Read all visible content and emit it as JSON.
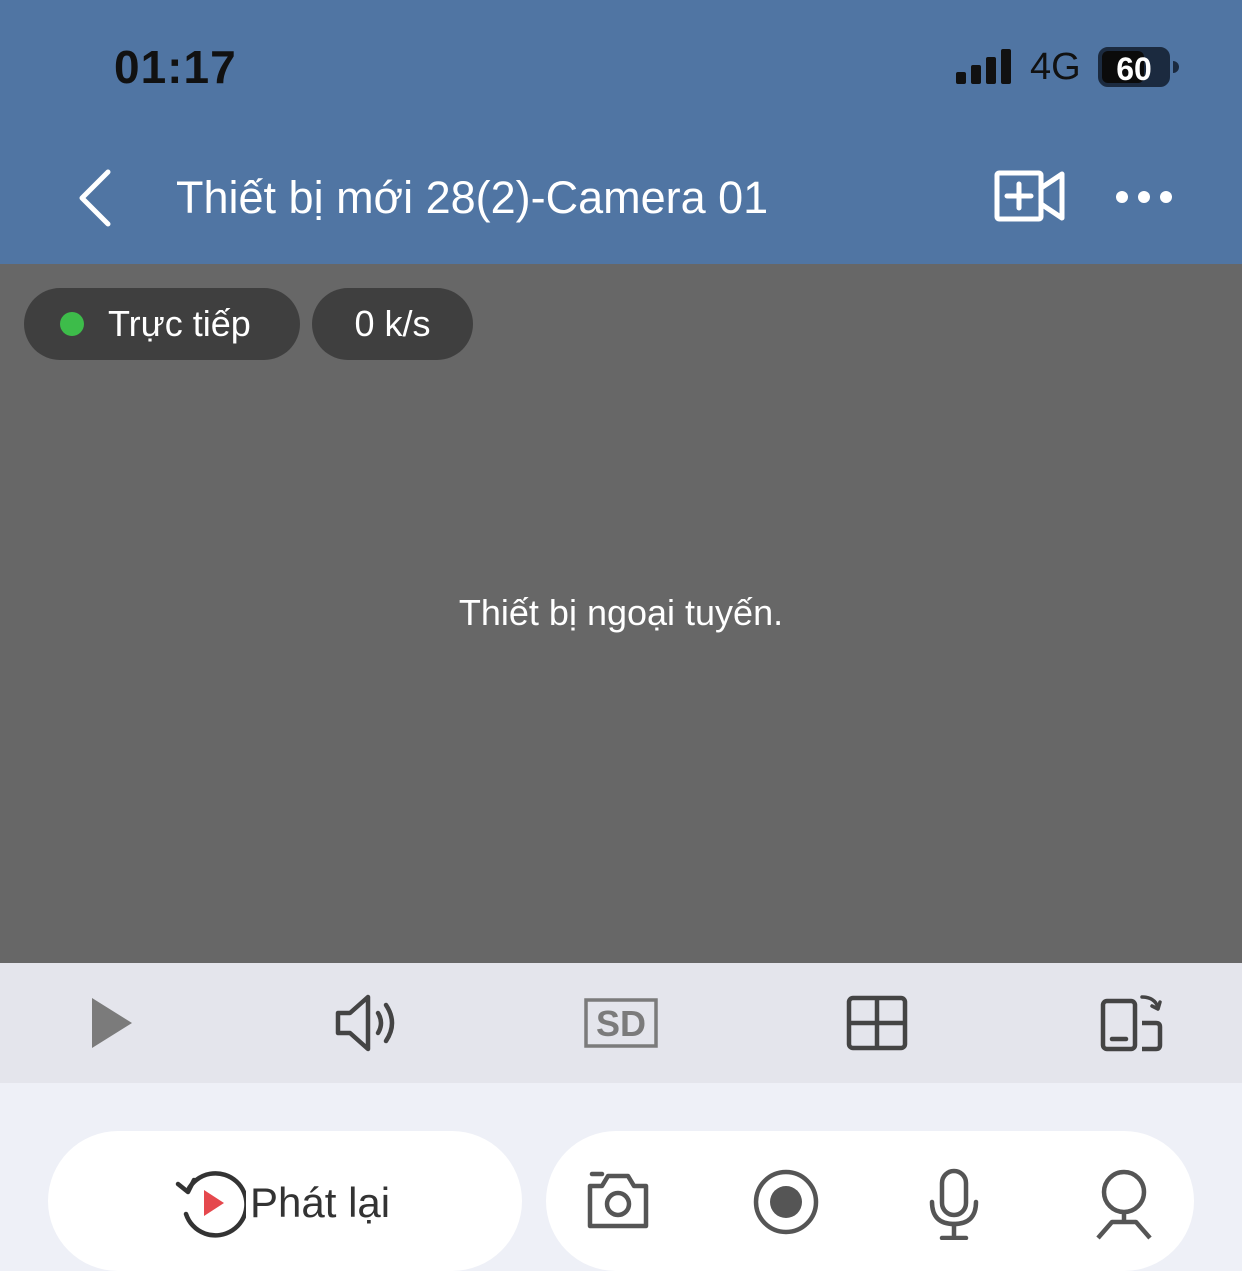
{
  "status_bar": {
    "time": "01:17",
    "network": "4G",
    "battery": "60"
  },
  "nav": {
    "title": "Thiết bị mới 28(2)-Camera 01"
  },
  "video": {
    "live_label": "Trực tiếp",
    "bitrate": "0 k/s",
    "offline_message": "Thiết bị ngoại tuyến."
  },
  "controls": {
    "quality": "SD"
  },
  "bottom": {
    "playback_label": "Phát lại"
  },
  "colors": {
    "header": "#5075a3",
    "video_bg": "#676767",
    "live_dot": "#3dbc4a",
    "playback_accent": "#e5484d"
  }
}
